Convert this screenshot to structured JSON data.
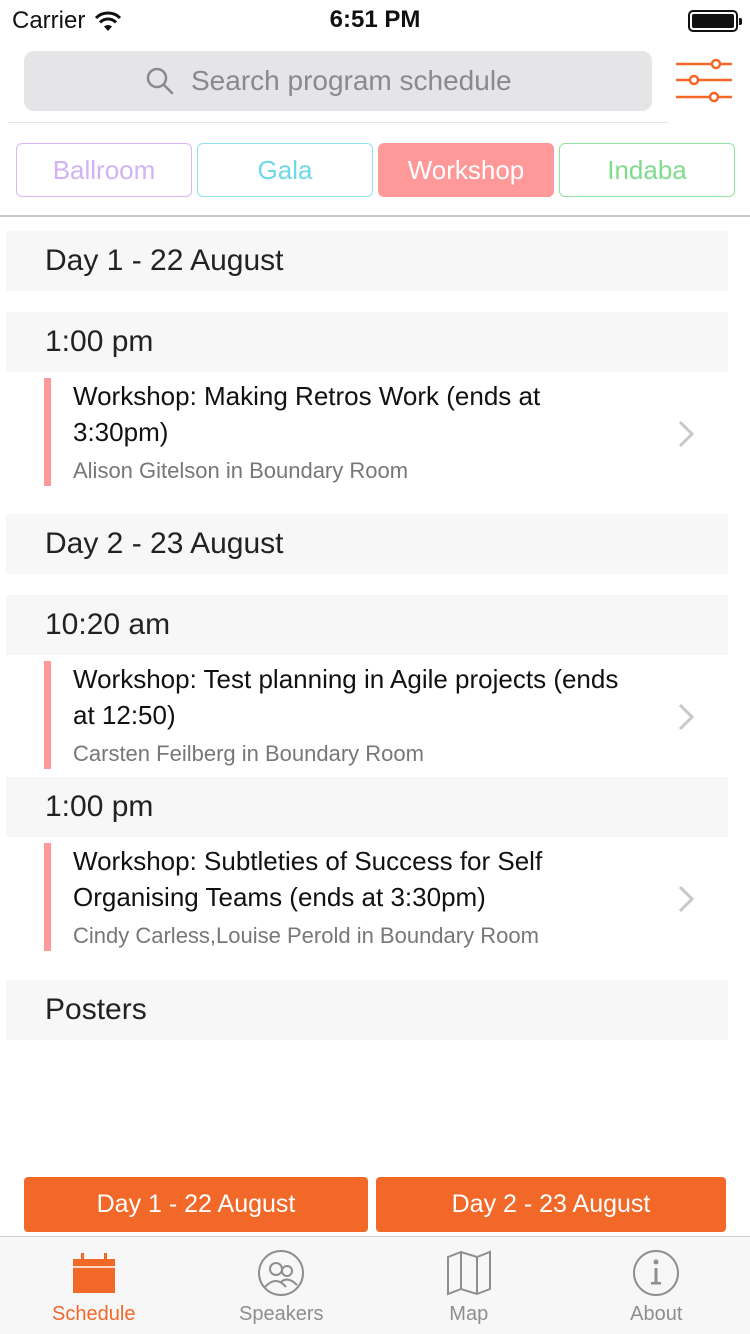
{
  "status_bar": {
    "carrier": "Carrier",
    "time": "6:51 PM"
  },
  "search": {
    "placeholder": "Search program schedule"
  },
  "tags": [
    {
      "label": "Ballroom",
      "color": "#d1b3f3",
      "selected": false
    },
    {
      "label": "Gala",
      "color": "#6fd8e8",
      "selected": false
    },
    {
      "label": "Workshop",
      "color": "#ff9898",
      "selected": true
    },
    {
      "label": "Indaba",
      "color": "#7fdc8d",
      "selected": false
    }
  ],
  "schedule": {
    "day1": {
      "heading": "Day 1 - 22 August",
      "slot1": {
        "time": "1:00 pm",
        "session": {
          "title": "Workshop: Making Retros Work (ends at 3:30pm)",
          "speaker": "Alison Gitelson in Boundary Room"
        }
      }
    },
    "day2": {
      "heading": "Day 2 - 23 August",
      "slot1": {
        "time": "10:20 am",
        "session": {
          "title": "Workshop: Test planning in Agile projects (ends at 12:50)",
          "speaker": "Carsten Feilberg in Boundary Room"
        }
      },
      "slot2": {
        "time": "1:00 pm",
        "session": {
          "title": "Workshop: Subtleties of Success for Self Organising Teams (ends at 3:30pm)",
          "speaker": "Cindy Carless,Louise Perold in Boundary Room"
        }
      }
    },
    "posters": {
      "heading": "Posters"
    }
  },
  "day_buttons": [
    {
      "label": "Day 1 - 22 August"
    },
    {
      "label": "Day 2 - 23 August"
    }
  ],
  "tab_bar": {
    "active_color": "#f26828",
    "tabs": [
      {
        "label": "Schedule",
        "icon": "calendar-icon",
        "active": true
      },
      {
        "label": "Speakers",
        "icon": "speakers-icon",
        "active": false
      },
      {
        "label": "Map",
        "icon": "map-icon",
        "active": false
      },
      {
        "label": "About",
        "icon": "info-icon",
        "active": false
      }
    ]
  }
}
